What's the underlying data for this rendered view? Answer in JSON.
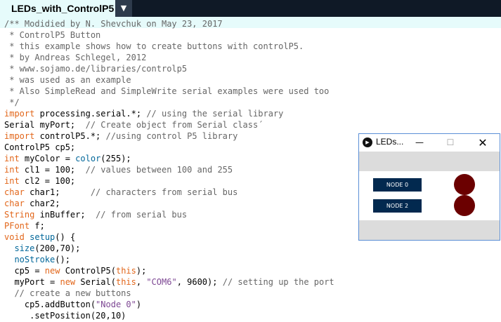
{
  "tab": {
    "name": "LEDs_with_ControlP5",
    "menu_glyph": "▼"
  },
  "code_lines": [
    [
      {
        "t": "/** Modidied by N. Shevchuk on May 23, 2017",
        "c": "c"
      }
    ],
    [
      {
        "t": " * ControlP5 Button",
        "c": "c"
      }
    ],
    [
      {
        "t": " * this example shows how to create buttons with controlP5.",
        "c": "c"
      }
    ],
    [
      {
        "t": " * by Andreas Schlegel, 2012",
        "c": "c"
      }
    ],
    [
      {
        "t": " * www.sojamo.de/libraries/controlp5",
        "c": "c"
      }
    ],
    [
      {
        "t": " * was used as an example",
        "c": "c"
      }
    ],
    [
      {
        "t": " * Also SimpleRead and SimpleWrite serial examples were used too",
        "c": "c"
      }
    ],
    [
      {
        "t": " */",
        "c": "c"
      }
    ],
    [
      {
        "t": "import",
        "c": "k"
      },
      {
        "t": " processing.serial.*; ",
        "c": "n"
      },
      {
        "t": "// using the serial library",
        "c": "c"
      }
    ],
    [
      {
        "t": "Serial myPort;  ",
        "c": "n"
      },
      {
        "t": "// Create object from Serial class´",
        "c": "c"
      }
    ],
    [
      {
        "t": "import",
        "c": "k"
      },
      {
        "t": " controlP5.*; ",
        "c": "n"
      },
      {
        "t": "//using control P5 library",
        "c": "c"
      }
    ],
    [
      {
        "t": "ControlP5 cp5;",
        "c": "n"
      }
    ],
    [
      {
        "t": "int",
        "c": "t"
      },
      {
        "t": " myColor = ",
        "c": "n"
      },
      {
        "t": "color",
        "c": "f"
      },
      {
        "t": "(255);",
        "c": "n"
      }
    ],
    [
      {
        "t": "int",
        "c": "t"
      },
      {
        "t": " cl1 = 100;  ",
        "c": "n"
      },
      {
        "t": "// values between 100 and 255",
        "c": "c"
      }
    ],
    [
      {
        "t": "int",
        "c": "t"
      },
      {
        "t": " cl2 = 100;",
        "c": "n"
      }
    ],
    [
      {
        "t": "char",
        "c": "t"
      },
      {
        "t": " char1;      ",
        "c": "n"
      },
      {
        "t": "// characters from serial bus",
        "c": "c"
      }
    ],
    [
      {
        "t": "char",
        "c": "t"
      },
      {
        "t": " char2;",
        "c": "n"
      }
    ],
    [
      {
        "t": "String",
        "c": "t"
      },
      {
        "t": " inBuffer;  ",
        "c": "n"
      },
      {
        "t": "// from serial bus",
        "c": "c"
      }
    ],
    [
      {
        "t": "PFont",
        "c": "t"
      },
      {
        "t": " f;",
        "c": "n"
      }
    ],
    [
      {
        "t": "void",
        "c": "t"
      },
      {
        "t": " ",
        "c": "n"
      },
      {
        "t": "setup",
        "c": "f"
      },
      {
        "t": "() {",
        "c": "n"
      }
    ],
    [
      {
        "t": "  ",
        "c": "n"
      },
      {
        "t": "size",
        "c": "f"
      },
      {
        "t": "(200,70);",
        "c": "n"
      }
    ],
    [
      {
        "t": "  ",
        "c": "n"
      },
      {
        "t": "noStroke",
        "c": "f"
      },
      {
        "t": "();",
        "c": "n"
      }
    ],
    [
      {
        "t": "  cp5 = ",
        "c": "n"
      },
      {
        "t": "new",
        "c": "k"
      },
      {
        "t": " ControlP5(",
        "c": "n"
      },
      {
        "t": "this",
        "c": "k"
      },
      {
        "t": ");",
        "c": "n"
      }
    ],
    [
      {
        "t": "  myPort = ",
        "c": "n"
      },
      {
        "t": "new",
        "c": "k"
      },
      {
        "t": " Serial(",
        "c": "n"
      },
      {
        "t": "this",
        "c": "k"
      },
      {
        "t": ", ",
        "c": "n"
      },
      {
        "t": "\"COM6\"",
        "c": "s"
      },
      {
        "t": ", 9600); ",
        "c": "n"
      },
      {
        "t": "// setting up the port",
        "c": "c"
      }
    ],
    [
      {
        "t": "  ",
        "c": "n"
      },
      {
        "t": "// create a new buttons",
        "c": "c"
      }
    ],
    [
      {
        "t": "    cp5.addButton(",
        "c": "n"
      },
      {
        "t": "\"Node 0\"",
        "c": "s"
      },
      {
        "t": ")",
        "c": "n"
      }
    ],
    [
      {
        "t": "     .setPosition(20,10)",
        "c": "n"
      }
    ]
  ],
  "sketch_window": {
    "app_icon": "play-icon",
    "title": "LEDs...",
    "minimize_glyph": "—",
    "maximize_glyph": "☐",
    "close_glyph": "✕",
    "buttons": [
      {
        "label": "NODE 0"
      },
      {
        "label": "NODE 2"
      }
    ],
    "led_color": "#6b0000",
    "button_color": "#02294f"
  }
}
